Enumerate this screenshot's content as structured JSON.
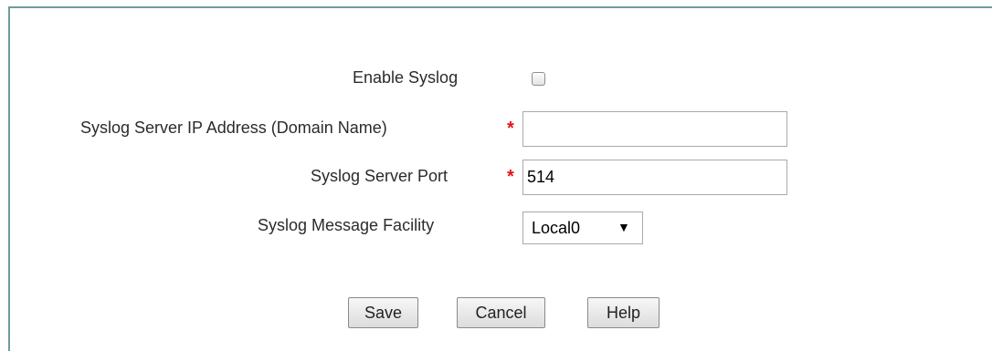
{
  "form": {
    "enable_syslog_label": "Enable Syslog",
    "enable_syslog_checked": false,
    "server_ip_label": "Syslog Server IP Address (Domain Name)",
    "server_ip_value": "",
    "server_port_label": "Syslog Server Port",
    "server_port_value": "514",
    "facility_label": "Syslog Message Facility",
    "facility_value": "Local0",
    "required_marker": "*"
  },
  "buttons": {
    "save": "Save",
    "cancel": "Cancel",
    "help": "Help"
  },
  "icons": {
    "dropdown": "chevron-down-icon"
  },
  "colors": {
    "frame_border": "#6e9c99",
    "required": "#e0161b"
  }
}
